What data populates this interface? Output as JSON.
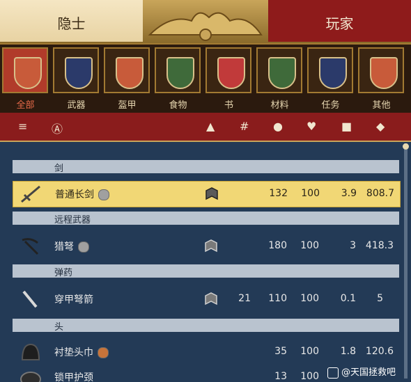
{
  "header": {
    "trader": "隐士",
    "player": "玩家"
  },
  "categories": [
    {
      "label": "全部",
      "icon": "all-goods-icon",
      "color": "#c85b3a",
      "active": true
    },
    {
      "label": "武器",
      "icon": "weapons-icon",
      "color": "#2b3a6a",
      "active": false
    },
    {
      "label": "盔甲",
      "icon": "armor-icon",
      "color": "#c85b3a",
      "active": false
    },
    {
      "label": "食物",
      "icon": "food-icon",
      "color": "#3f6a3a",
      "active": false
    },
    {
      "label": "书",
      "icon": "book-icon",
      "color": "#c13a3a",
      "active": false
    },
    {
      "label": "材料",
      "icon": "materials-icon",
      "color": "#3f6a3a",
      "active": false
    },
    {
      "label": "任务",
      "icon": "quest-icon",
      "color": "#2b3a6a",
      "active": false
    },
    {
      "label": "其他",
      "icon": "misc-icon",
      "color": "#c85b3a",
      "active": false
    }
  ],
  "sort_icons": [
    "sort-icon",
    "alphabetical-sort-icon",
    "shirt-icon",
    "hash-icon",
    "strength-icon",
    "heart-icon",
    "weight-icon",
    "coin-icon"
  ],
  "sections": [
    {
      "title": "剑"
    },
    {
      "title": "远程武器"
    },
    {
      "title": "弹药"
    },
    {
      "title": "头"
    }
  ],
  "items": [
    {
      "name": "普通长剑",
      "badge": "gray",
      "qty": "",
      "c1": "132",
      "c2": "100",
      "c3": "3.9",
      "c4": "808.7",
      "selected": true,
      "icon": "sword-icon"
    },
    {
      "name": "猎弩",
      "badge": "gray",
      "qty": "",
      "c1": "180",
      "c2": "100",
      "c3": "3",
      "c4": "418.3",
      "selected": false,
      "icon": "crossbow-icon"
    },
    {
      "name": "穿甲弩箭",
      "badge": "",
      "qty": "21",
      "c1": "110",
      "c2": "100",
      "c3": "0.1",
      "c4": "5",
      "selected": false,
      "icon": "bolt-icon"
    },
    {
      "name": "衬垫头巾",
      "badge": "orange",
      "qty": "",
      "c1": "35",
      "c2": "100",
      "c3": "1.8",
      "c4": "120.6",
      "selected": false,
      "icon": "coif-icon"
    },
    {
      "name": "锁甲护颈",
      "badge": "",
      "qty": "",
      "c1": "13",
      "c2": "100",
      "c3": "",
      "c4": "",
      "selected": false,
      "icon": "mail-collar-icon"
    }
  ],
  "watermark": "@天国拯救吧"
}
